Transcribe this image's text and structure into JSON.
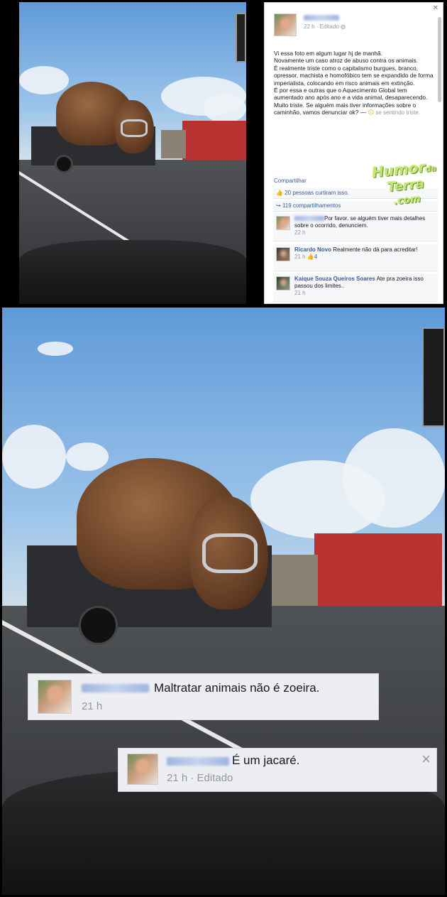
{
  "post": {
    "time_label": "22 h · Editado",
    "globe_icon": "globe-icon",
    "text_lines": [
      "Vi essa foto em algum lugar hj de manhã.",
      "Novamente um caso atroz de abuso contra os animais.",
      "É realmente triste como o capitalismo burgues, branco, opressor, machista e homofóbico tem se expandido de forma imperialista, colocando em risco animais em extinção.",
      "É por essa e outras que o Aquecimento Global tem aumentado ano após ano e a vida animal, desaparecendo.",
      "Muito triste. Se alguém mais tiver informações sobre o caminhão, vamos denunciar ok? — "
    ],
    "feeling": "se sentindo triste.",
    "share_label": "Compartilhar",
    "likes_label": "20 pessoas curtiram isso.",
    "shares_label": "119 compartilhamentos"
  },
  "comments": [
    {
      "name": "",
      "text": "Por favor, se alguém tiver mais detalhes sobre o ocorrido, denunciem.",
      "time": "22 h",
      "likes": ""
    },
    {
      "name": "Ricardo Novo",
      "text": "Realmente não dá para acreditar!",
      "time": "21 h",
      "likes": "4"
    },
    {
      "name": "Kaique Souza Queiros Soares",
      "text": "Ate pra zoeira isso passou dos limites..",
      "time": "21 h",
      "likes": ""
    }
  ],
  "watermark": {
    "line1": "Humor",
    "line2": "Terra",
    "line3": ".com",
    "suffix": "da"
  },
  "overlay_comments": [
    {
      "text": "Maltratar animais não é zoeira.",
      "time": "21 h"
    },
    {
      "text": "É um jacaré.",
      "time": "21 h · Editado",
      "close": "×"
    }
  ],
  "colors": {
    "fb_link": "#3b5998",
    "fb_bg": "#f6f7f8",
    "meta": "#9197a3"
  }
}
